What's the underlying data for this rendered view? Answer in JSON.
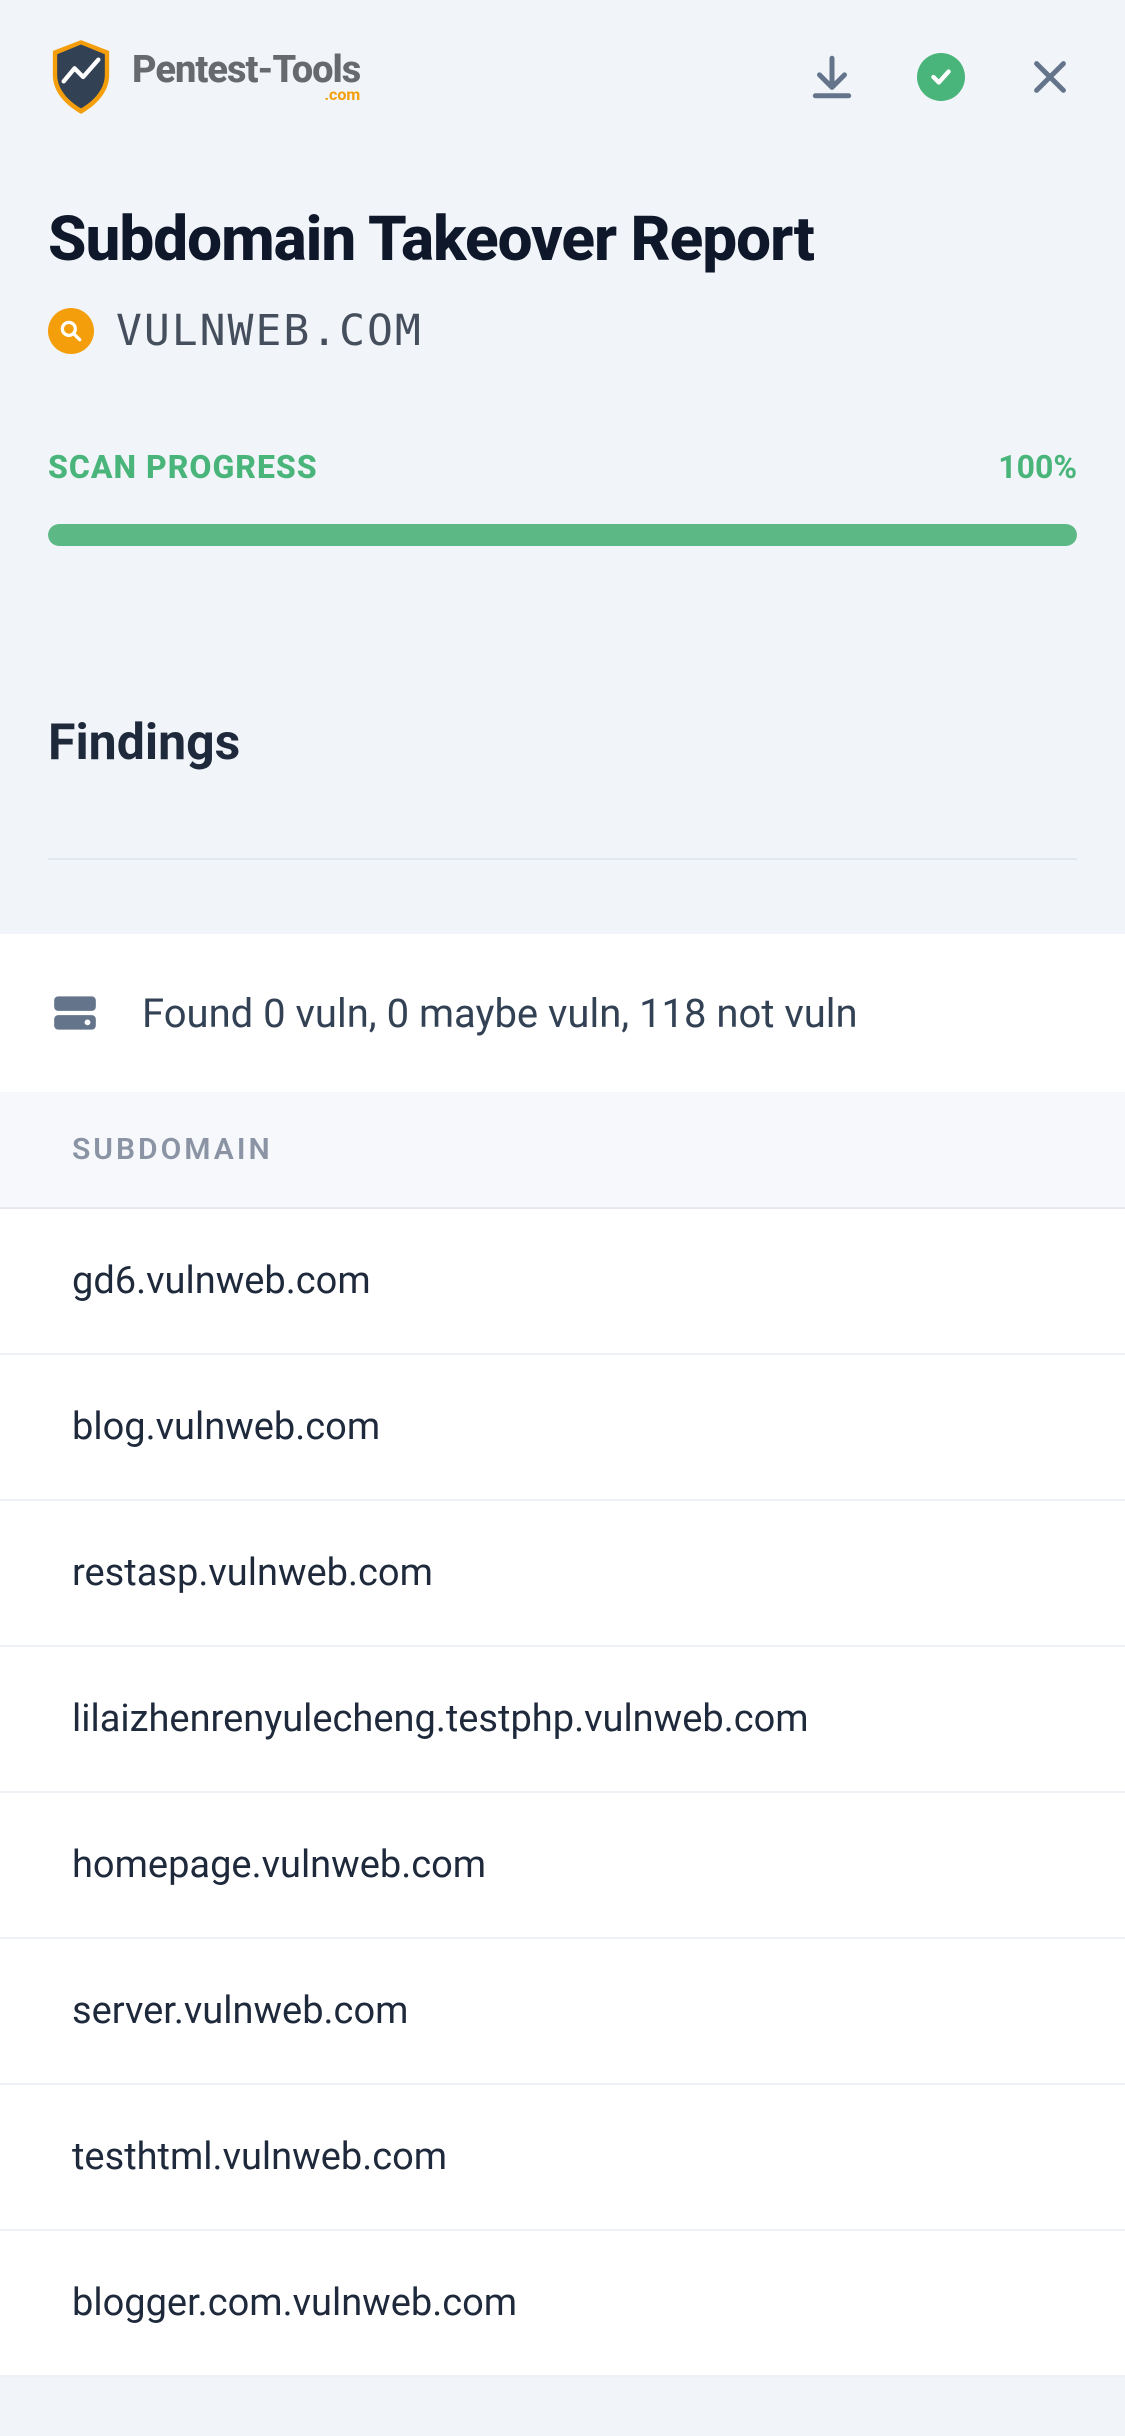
{
  "header": {
    "brand_main": "Pentest-Tools",
    "brand_sub": ".com"
  },
  "report": {
    "title": "Subdomain Takeover Report",
    "target": "VULNWEB.COM"
  },
  "progress": {
    "label": "SCAN PROGRESS",
    "value": "100%",
    "percent": 100
  },
  "findings": {
    "title": "Findings",
    "summary": "Found 0 vuln, 0 maybe vuln, 118 not vuln",
    "table_header": "SUBDOMAIN",
    "subdomains": [
      "gd6.vulnweb.com",
      "blog.vulnweb.com",
      "restasp.vulnweb.com",
      "lilaizhenrenyulecheng.testphp.vulnweb.com",
      "homepage.vulnweb.com",
      "server.vulnweb.com",
      "testhtml.vulnweb.com",
      "blogger.com.vulnweb.com"
    ]
  }
}
